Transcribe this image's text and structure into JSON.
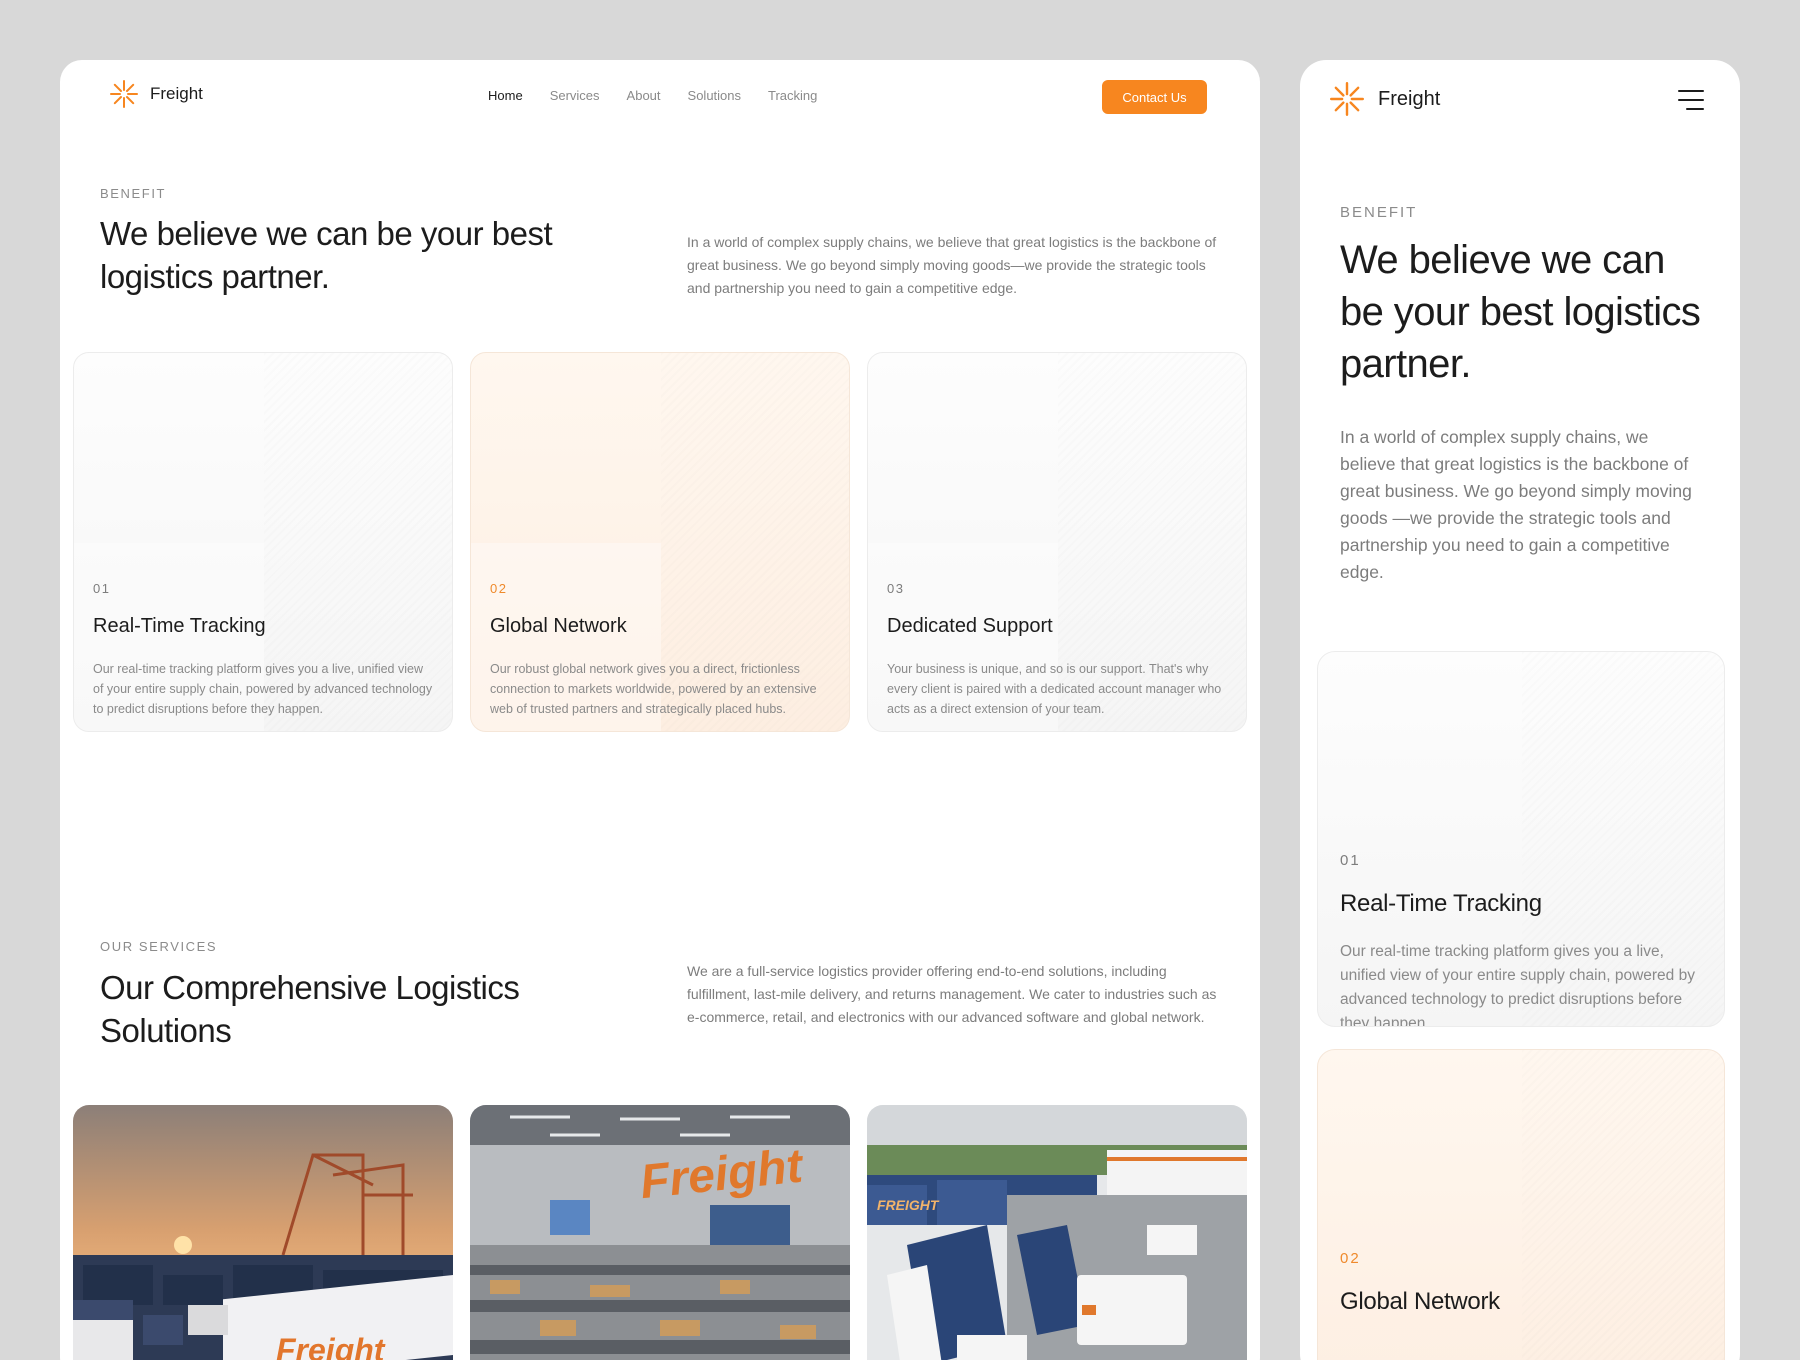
{
  "brand": {
    "name": "Freight",
    "accent": "#f7861f"
  },
  "nav": {
    "links": [
      {
        "label": "Home",
        "active": true
      },
      {
        "label": "Services",
        "active": false
      },
      {
        "label": "About",
        "active": false
      },
      {
        "label": "Solutions",
        "active": false
      },
      {
        "label": "Tracking",
        "active": false
      }
    ],
    "cta": "Contact Us"
  },
  "benefit": {
    "eyebrow": "BENEFIT",
    "title": "We believe we can be your best logistics partner.",
    "lead": "In a world of complex supply chains, we believe that great logistics is the backbone of great business. We go beyond simply moving goods—we provide the strategic tools and partnership you need to gain a competitive edge.",
    "lead_mobile": "In a world of complex supply chains, we believe that great logistics is the backbone of great business. We go beyond simply moving goods —we provide the strategic tools and partnership you need to gain a competitive edge.",
    "cards": [
      {
        "num": "01",
        "title": "Real-Time Tracking",
        "desc": "Our real-time tracking platform gives you a live, unified view of your entire supply chain, powered by advanced technology to predict disruptions before they happen."
      },
      {
        "num": "02",
        "title": "Global Network",
        "desc": "Our robust global network gives you a direct, frictionless connection to markets worldwide, powered by an extensive web of trusted partners and strategically placed hubs."
      },
      {
        "num": "03",
        "title": "Dedicated Support",
        "desc": "Your business is unique, and so is our support. That's why every client is paired with a dedicated account manager who acts as a direct extension of your team."
      }
    ]
  },
  "services": {
    "eyebrow": "OUR SERVICES",
    "title": "Our Comprehensive Logistics Solutions",
    "lead": "We are a full-service logistics provider offering end-to-end solutions, including fulfillment, last-mile delivery, and returns management. We cater to industries such as e-commerce, retail, and electronics with our advanced software and global network.",
    "photos": [
      {
        "name": "port-sunset-photo",
        "sign": "Freight"
      },
      {
        "name": "warehouse-photo",
        "sign": "Freight"
      },
      {
        "name": "truck-yard-photo",
        "sign": "FREIGHT"
      }
    ]
  },
  "icons": {
    "logo": "asterisk-burst-icon",
    "menu": "hamburger-menu-icon"
  }
}
